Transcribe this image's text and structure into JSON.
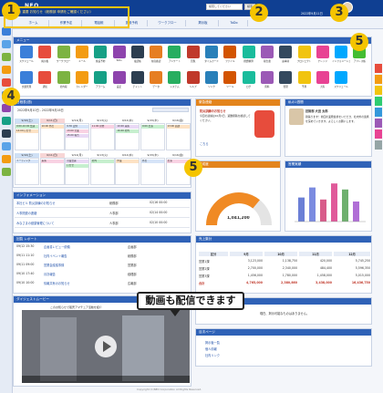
{
  "app": {
    "logo": "NEO",
    "user": "ユーザー 太郎",
    "date": "2022年9月11日",
    "right": "設定"
  },
  "message": "緊急 重要 お知らせ（総務部 申請をご確認ください）",
  "search": {
    "placeholder": "検索してください",
    "button": "検索"
  },
  "badges": [
    "1",
    "2",
    "3",
    "4",
    "5",
    "5"
  ],
  "nav": [
    "ホーム",
    "作業予定",
    "電話帳",
    "施設予約",
    "ワークフロー",
    "掲示板",
    "ToDo"
  ],
  "menu": {
    "title": "メニュー",
    "items": [
      "スケジュール",
      "掲示板",
      "ワークフロー",
      "メール",
      "施設予約",
      "ToDo",
      "電話帳",
      "在席確認",
      "アンケート",
      "回覧",
      "タイムカード",
      "ファイル",
      "経費精算",
      "報告書",
      "議事録",
      "プロジェクト",
      "ナレッジ",
      "インフォメーション",
      "アドレス帳",
      "文書管理",
      "通知",
      "社内報",
      "カレンダー",
      "アラーム",
      "設定",
      "チャット",
      "データ",
      "システム",
      "ヘルプ",
      "リンク",
      "ツール",
      "ログ",
      "資料",
      "管理",
      "予算",
      "共有",
      "スケジュール"
    ]
  },
  "calendar": {
    "title": "日程表(週)",
    "range": "2022年9月10日 - 2022年9月16日",
    "days": [
      "9/10(土)",
      "9/11(日)",
      "9/12(月)",
      "9/13(火)",
      "9/14(水)",
      "9/15(木)",
      "9/16(金)"
    ],
    "events": [
      [
        "9:00-10:00 会議",
        "14:00 打合せ"
      ],
      [
        "10:00 外出"
      ],
      [
        "9:30 定例",
        "13:00 営業",
        "15:00 報告"
      ],
      [
        "11:00 研修"
      ],
      [
        "10:00 来客",
        "16:00 社内"
      ],
      [
        "9:00 出張"
      ],
      [
        "13:00 面談"
      ]
    ],
    "events2": [
      [
        "ミーティング"
      ],
      [
        "来客"
      ],
      [
        "営業会議",
        "打合せ"
      ],
      [
        "社内"
      ],
      [
        "作業"
      ],
      [
        "外出"
      ],
      [
        "出張"
      ]
    ]
  },
  "info": {
    "title": "インフォメーション",
    "rows": [
      [
        "本社ビル 防災訓練のお知らせ",
        "総務部",
        "02/16 00:00"
      ],
      [
        "人事関連の連絡",
        "人事部",
        "02/14 00:00"
      ],
      [
        "みなさまの健康管理について",
        "人事部",
        "02/10 00:00"
      ]
    ]
  },
  "reports": {
    "title": "回覧 レポート",
    "rows": [
      [
        "09/12 15:30",
        "企画書レビュー依頼",
        "企画部"
      ],
      [
        "09/11 11:10",
        "社内イベント報告",
        "総務部"
      ],
      [
        "09/11 09:00",
        "営業会議議事録",
        "営業部"
      ],
      [
        "09/10 17:40",
        "月次報告",
        "経理部"
      ],
      [
        "09/10 10:00",
        "情報共有のお知らせ",
        "広報部"
      ]
    ]
  },
  "notice": {
    "title": "緊急連絡",
    "heading": "防災訓練のお知らせ",
    "body": "今回の訓練は10月1日、避難経路を確認してください。",
    "link": "こちら"
  },
  "profile": {
    "title": "私の1週間",
    "name": "技術部 大田 太郎",
    "text": "頑張ります！前回の業務進捗をいただき、社内外の連携を深めていきます。よろしくお願いします。"
  },
  "gauge": {
    "title": "達成度",
    "value": "1,041,200",
    "fill": 0.72
  },
  "bars": {
    "title": "営業実績",
    "values": [
      60,
      85,
      55,
      95,
      80,
      50
    ],
    "colors": [
      "#6b7fd6",
      "#7b8be0",
      "#d85c8a",
      "#e05a9a",
      "#6fb06f",
      "#b06fd6"
    ]
  },
  "sales": {
    "title": "売上集計",
    "header": [
      "区分",
      "9月",
      "10月",
      "11月",
      "12月"
    ],
    "rows": [
      [
        "営業1課",
        "3,123,000",
        "1,138,750",
        "420,000",
        "5,745,250"
      ],
      [
        "営業2課",
        "2,700,000",
        "2,340,000",
        "484,400",
        "5,596,350"
      ],
      [
        "営業3課",
        "1,456,000",
        "1,780,000",
        "1,458,000",
        "5,015,000"
      ],
      [
        "合計",
        "4,765,000",
        "2,380,860",
        "3,438,000",
        "16,436,750"
      ]
    ]
  },
  "video": {
    "title": "ダイジェストムービー",
    "caption": "動画も配信できます",
    "subtitle": "このお知らせで販売アマチュア活動を紹介"
  },
  "side_text": {
    "title": "掲示板",
    "body": "現在、掲示可能なものはありません。"
  },
  "toc": {
    "title": "目次ページ",
    "items": [
      "掲示板一覧",
      "個人情報",
      "社内リンク"
    ]
  },
  "footer": "Copyright (C)NEO Corporation All Rights Reserved."
}
